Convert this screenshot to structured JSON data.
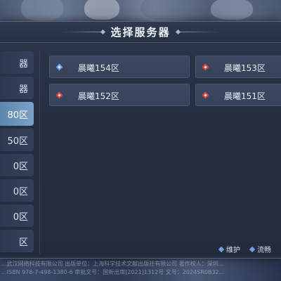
{
  "dialog": {
    "title": "选择服务器"
  },
  "side_list": [
    {
      "label": "器",
      "active": false
    },
    {
      "label": "器",
      "active": false
    },
    {
      "label": "80区",
      "active": true
    },
    {
      "label": "50区",
      "active": false
    },
    {
      "label": "0区",
      "active": false
    },
    {
      "label": "0区",
      "active": false
    },
    {
      "label": "0区",
      "active": false
    },
    {
      "label": "区",
      "active": false
    }
  ],
  "servers": [
    {
      "name": "晨曦154区",
      "status": "maintenance",
      "status_color": "#6f9fe0"
    },
    {
      "name": "晨曦153区",
      "status": "smooth",
      "status_color": "#d8493d"
    },
    {
      "name": "晨曦152区",
      "status": "smooth",
      "status_color": "#d8493d"
    },
    {
      "name": "晨曦151区",
      "status": "smooth",
      "status_color": "#d8493d"
    }
  ],
  "legend": {
    "maintenance_label": "维护",
    "maintenance_color": "#6f9fe0",
    "smooth_label": "流畅",
    "smooth_color": "#6f9fe0"
  },
  "footer": {
    "line1": "...武汉网络科技有限公司   出版单位：上海科学技术文献出版社有限公司   著作权人：深圳...",
    "line2": "...ISBN 978-7-498-1380-6   审批文号：国新出审[2021]1312号   文号：2024SR0B32..."
  }
}
